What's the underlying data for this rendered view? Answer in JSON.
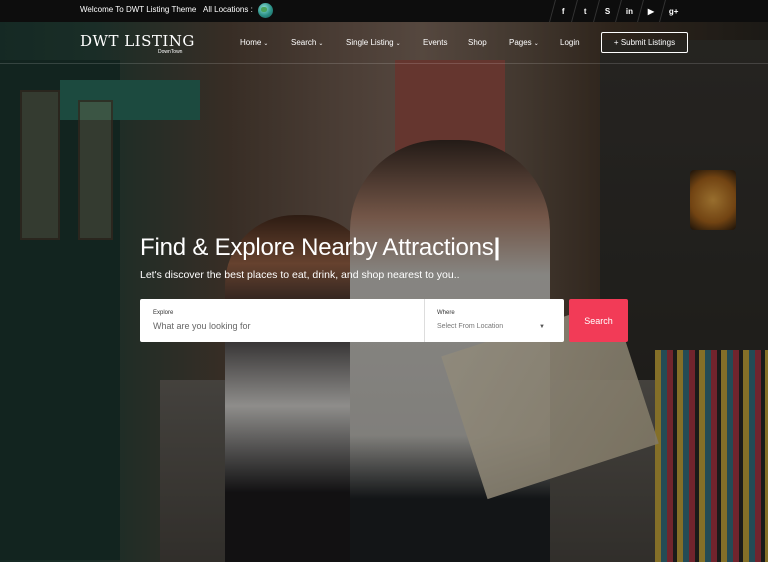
{
  "topbar": {
    "welcome": "Welcome To DWT Listing Theme",
    "locations": "All Locations :",
    "social": [
      {
        "icon": "facebook-icon",
        "glyph": "f"
      },
      {
        "icon": "twitter-icon",
        "glyph": "t"
      },
      {
        "icon": "skype-icon",
        "glyph": "S"
      },
      {
        "icon": "linkedin-icon",
        "glyph": "in"
      },
      {
        "icon": "youtube-icon",
        "glyph": "▶"
      },
      {
        "icon": "google-plus-icon",
        "glyph": "g+"
      }
    ]
  },
  "nav": {
    "logo": "DWT LISTING",
    "logo_sub": "DownTown",
    "items": [
      {
        "label": "Home",
        "has_dropdown": true
      },
      {
        "label": "Search",
        "has_dropdown": true
      },
      {
        "label": "Single Listing",
        "has_dropdown": true
      },
      {
        "label": "Events",
        "has_dropdown": false
      },
      {
        "label": "Shop",
        "has_dropdown": false
      },
      {
        "label": "Pages",
        "has_dropdown": true
      },
      {
        "label": "Login",
        "has_dropdown": false
      }
    ],
    "submit_label": "+ Submit Listings"
  },
  "hero": {
    "headline": "Find & Explore Nearby Attractions",
    "cursor": "|",
    "subline": "Let's discover the best places to eat, drink, and shop nearest to you.."
  },
  "search": {
    "explore_label": "Explore",
    "explore_placeholder": "What are you looking for",
    "where_label": "Where",
    "where_placeholder": "Select From Location",
    "button": "Search"
  },
  "colors": {
    "accent": "#f23b57",
    "topbar_bg": "#0d0d0d"
  }
}
